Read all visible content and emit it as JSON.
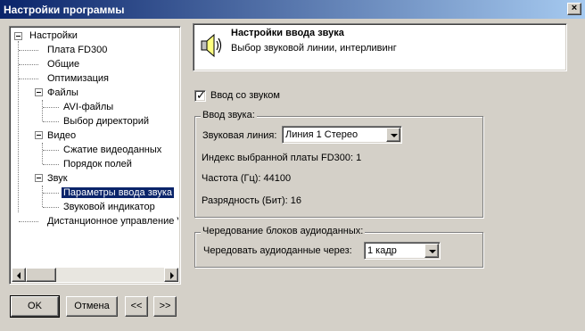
{
  "window": {
    "title": "Настройки программы",
    "close": "×"
  },
  "tree": {
    "items": [
      {
        "label": "Настройки"
      },
      {
        "label": "Плата FD300"
      },
      {
        "label": "Общие"
      },
      {
        "label": "Оптимизация"
      },
      {
        "label": "Файлы"
      },
      {
        "label": "AVI-файлы"
      },
      {
        "label": "Выбор директорий"
      },
      {
        "label": "Видео"
      },
      {
        "label": "Сжатие видеоданных"
      },
      {
        "label": "Порядок полей"
      },
      {
        "label": "Звук"
      },
      {
        "label": "Параметры ввода звука"
      },
      {
        "label": "Звуковой индикатор"
      },
      {
        "label": "Дистанционное управление V"
      }
    ]
  },
  "buttons": {
    "ok": "OK",
    "cancel": "Отмена",
    "prev": "<<",
    "next": ">>"
  },
  "header": {
    "title": "Настройки ввода звука",
    "subtitle": "Выбор звуковой линии, интерливинг",
    "icon": "speaker-icon"
  },
  "sound_input": {
    "checkbox_label": "Ввод со звуком",
    "checked": true,
    "group_title": "Ввод звука:",
    "line_label": "Звуковая линия:",
    "line_value": "Линия 1 Стерео",
    "board_index": "Индекс выбранной платы FD300: 1",
    "frequency": "Частота (Гц): 44100",
    "bit_depth": "Разрядность (Бит): 16"
  },
  "interleave": {
    "group_title": "Чередование блоков аудиоданных:",
    "label": "Чередовать аудиоданные через:",
    "value": "1 кадр"
  },
  "colors": {
    "titlebar": "#0a246a",
    "face": "#d4d0c8",
    "selection": "#0a246a"
  }
}
